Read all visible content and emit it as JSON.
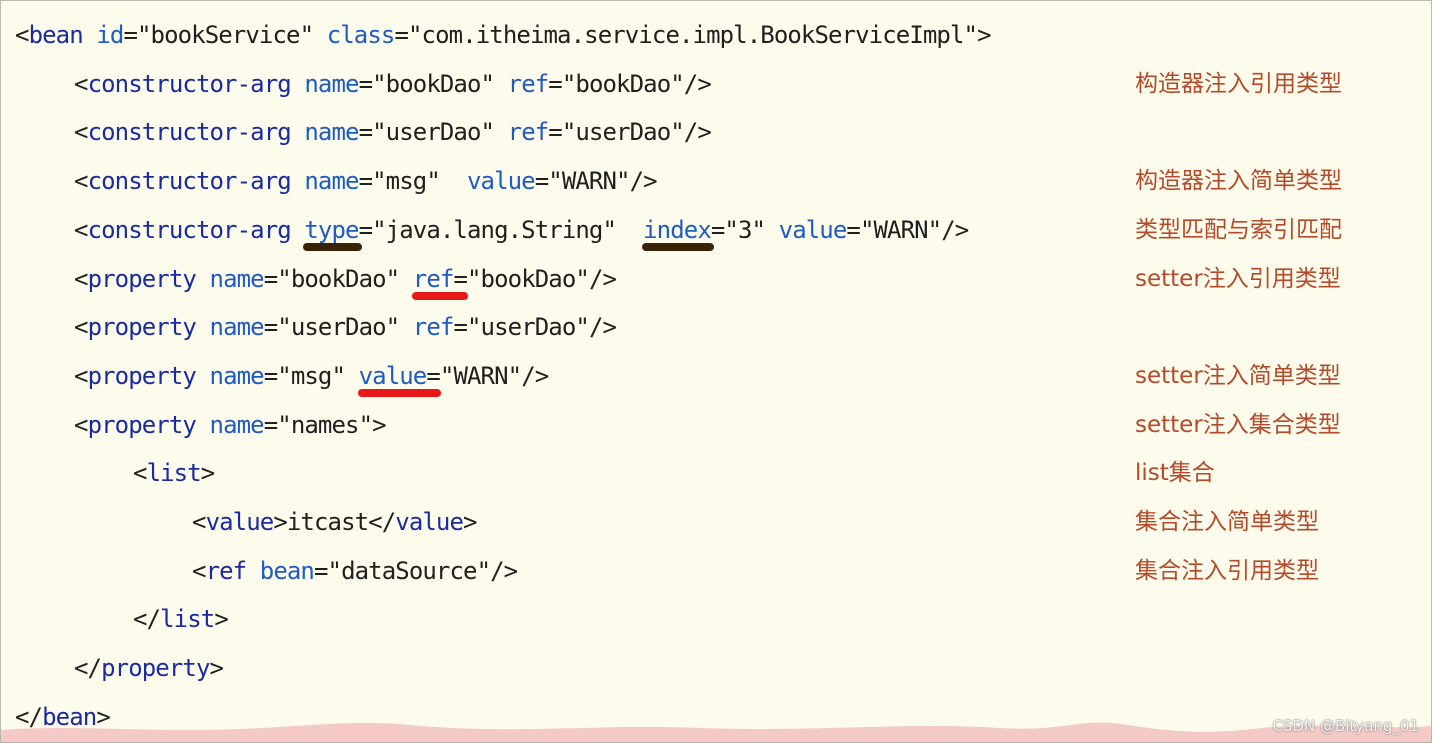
{
  "code_lines": [
    {
      "indent": 0,
      "parts": [
        {
          "t": "<",
          "c": "punc"
        },
        {
          "t": "bean",
          "c": "kw-tag"
        },
        {
          "t": " ",
          "c": "txt"
        },
        {
          "t": "id",
          "c": "kw-attr"
        },
        {
          "t": "=\"bookService\"",
          "c": "str"
        },
        {
          "t": " ",
          "c": "txt"
        },
        {
          "t": "class",
          "c": "kw-attr"
        },
        {
          "t": "=\"com.itheima.service.impl.BookServiceImpl\"",
          "c": "str"
        },
        {
          "t": ">",
          "c": "punc"
        }
      ]
    },
    {
      "indent": 1,
      "parts": [
        {
          "t": "<",
          "c": "punc"
        },
        {
          "t": "constructor-arg",
          "c": "kw-tag"
        },
        {
          "t": " ",
          "c": "txt"
        },
        {
          "t": "name",
          "c": "kw-attr"
        },
        {
          "t": "=\"bookDao\"",
          "c": "str"
        },
        {
          "t": " ",
          "c": "txt"
        },
        {
          "t": "ref",
          "c": "kw-attr"
        },
        {
          "t": "=\"bookDao\"",
          "c": "str"
        },
        {
          "t": "/>",
          "c": "punc"
        }
      ]
    },
    {
      "indent": 1,
      "parts": [
        {
          "t": "<",
          "c": "punc"
        },
        {
          "t": "constructor-arg",
          "c": "kw-tag"
        },
        {
          "t": " ",
          "c": "txt"
        },
        {
          "t": "name",
          "c": "kw-attr"
        },
        {
          "t": "=\"userDao\"",
          "c": "str"
        },
        {
          "t": " ",
          "c": "txt"
        },
        {
          "t": "ref",
          "c": "kw-attr"
        },
        {
          "t": "=\"userDao\"",
          "c": "str"
        },
        {
          "t": "/>",
          "c": "punc"
        }
      ]
    },
    {
      "indent": 1,
      "parts": [
        {
          "t": "<",
          "c": "punc"
        },
        {
          "t": "constructor-arg",
          "c": "kw-tag"
        },
        {
          "t": " ",
          "c": "txt"
        },
        {
          "t": "name",
          "c": "kw-attr"
        },
        {
          "t": "=\"msg\"",
          "c": "str"
        },
        {
          "t": "  ",
          "c": "txt"
        },
        {
          "t": "value",
          "c": "kw-attr"
        },
        {
          "t": "=\"WARN\"",
          "c": "str"
        },
        {
          "t": "/>",
          "c": "punc"
        }
      ]
    },
    {
      "indent": 1,
      "parts": [
        {
          "t": "<",
          "c": "punc"
        },
        {
          "t": "constructor-arg",
          "c": "kw-tag"
        },
        {
          "t": " ",
          "c": "txt"
        },
        {
          "t": "type",
          "c": "kw-attr"
        },
        {
          "t": "=\"java.lang.String\"",
          "c": "str"
        },
        {
          "t": "  ",
          "c": "txt"
        },
        {
          "t": "index",
          "c": "kw-attr"
        },
        {
          "t": "=\"3\"",
          "c": "str"
        },
        {
          "t": " ",
          "c": "txt"
        },
        {
          "t": "value",
          "c": "kw-attr"
        },
        {
          "t": "=\"WARN\"",
          "c": "str"
        },
        {
          "t": "/>",
          "c": "punc"
        }
      ]
    },
    {
      "indent": 1,
      "parts": [
        {
          "t": "<",
          "c": "punc"
        },
        {
          "t": "property",
          "c": "kw-tag"
        },
        {
          "t": " ",
          "c": "txt"
        },
        {
          "t": "name",
          "c": "kw-attr"
        },
        {
          "t": "=\"bookDao\"",
          "c": "str"
        },
        {
          "t": " ",
          "c": "txt"
        },
        {
          "t": "ref",
          "c": "kw-attr"
        },
        {
          "t": "=\"bookDao\"",
          "c": "str"
        },
        {
          "t": "/>",
          "c": "punc"
        }
      ]
    },
    {
      "indent": 1,
      "parts": [
        {
          "t": "<",
          "c": "punc"
        },
        {
          "t": "property",
          "c": "kw-tag"
        },
        {
          "t": " ",
          "c": "txt"
        },
        {
          "t": "name",
          "c": "kw-attr"
        },
        {
          "t": "=\"userDao\"",
          "c": "str"
        },
        {
          "t": " ",
          "c": "txt"
        },
        {
          "t": "ref",
          "c": "kw-attr"
        },
        {
          "t": "=\"userDao\"",
          "c": "str"
        },
        {
          "t": "/>",
          "c": "punc"
        }
      ]
    },
    {
      "indent": 1,
      "parts": [
        {
          "t": "<",
          "c": "punc"
        },
        {
          "t": "property",
          "c": "kw-tag"
        },
        {
          "t": " ",
          "c": "txt"
        },
        {
          "t": "name",
          "c": "kw-attr"
        },
        {
          "t": "=\"msg\"",
          "c": "str"
        },
        {
          "t": " ",
          "c": "txt"
        },
        {
          "t": "value",
          "c": "kw-attr"
        },
        {
          "t": "=\"WARN\"",
          "c": "str"
        },
        {
          "t": "/>",
          "c": "punc"
        }
      ]
    },
    {
      "indent": 1,
      "parts": [
        {
          "t": "<",
          "c": "punc"
        },
        {
          "t": "property",
          "c": "kw-tag"
        },
        {
          "t": " ",
          "c": "txt"
        },
        {
          "t": "name",
          "c": "kw-attr"
        },
        {
          "t": "=\"names\"",
          "c": "str"
        },
        {
          "t": ">",
          "c": "punc"
        }
      ]
    },
    {
      "indent": 2,
      "parts": [
        {
          "t": "<",
          "c": "punc"
        },
        {
          "t": "list",
          "c": "kw-tag"
        },
        {
          "t": ">",
          "c": "punc"
        }
      ]
    },
    {
      "indent": 3,
      "parts": [
        {
          "t": "<",
          "c": "punc"
        },
        {
          "t": "value",
          "c": "kw-tag"
        },
        {
          "t": ">",
          "c": "punc"
        },
        {
          "t": "itcast",
          "c": "txt"
        },
        {
          "t": "</",
          "c": "punc"
        },
        {
          "t": "value",
          "c": "kw-tag"
        },
        {
          "t": ">",
          "c": "punc"
        }
      ]
    },
    {
      "indent": 3,
      "parts": [
        {
          "t": "<",
          "c": "punc"
        },
        {
          "t": "ref",
          "c": "kw-tag"
        },
        {
          "t": " ",
          "c": "txt"
        },
        {
          "t": "bean",
          "c": "kw-attr"
        },
        {
          "t": "=\"dataSource\"",
          "c": "str"
        },
        {
          "t": "/>",
          "c": "punc"
        }
      ]
    },
    {
      "indent": 2,
      "parts": [
        {
          "t": "</",
          "c": "punc"
        },
        {
          "t": "list",
          "c": "kw-tag"
        },
        {
          "t": ">",
          "c": "punc"
        }
      ]
    },
    {
      "indent": 1,
      "parts": [
        {
          "t": "</",
          "c": "punc"
        },
        {
          "t": "property",
          "c": "kw-tag"
        },
        {
          "t": ">",
          "c": "punc"
        }
      ]
    },
    {
      "indent": 0,
      "parts": [
        {
          "t": "</",
          "c": "punc"
        },
        {
          "t": "bean",
          "c": "kw-tag"
        },
        {
          "t": ">",
          "c": "punc"
        }
      ]
    }
  ],
  "annotations": [
    {
      "line": 1,
      "text": "构造器注入引用类型"
    },
    {
      "line": 3,
      "text": "构造器注入简单类型"
    },
    {
      "line": 4,
      "text": "类型匹配与索引匹配"
    },
    {
      "line": 5,
      "text": "setter注入引用类型"
    },
    {
      "line": 7,
      "text": "setter注入简单类型"
    },
    {
      "line": 8,
      "text": "setter注入集合类型"
    },
    {
      "line": 9,
      "text": "list集合"
    },
    {
      "line": 10,
      "text": "集合注入简单类型"
    },
    {
      "line": 11,
      "text": "集合注入引用类型"
    }
  ],
  "highlight_marks": [
    {
      "line": 4,
      "target": "type",
      "color": "#3a2208"
    },
    {
      "line": 4,
      "target": "index",
      "color": "#3a2208"
    },
    {
      "line": 5,
      "target": "ref",
      "color": "#e81818"
    },
    {
      "line": 7,
      "target": "value",
      "color": "#e81818"
    }
  ],
  "colors": {
    "background": "#fdfbeb",
    "tag": "#1a2aa2",
    "attribute": "#1f5bc4",
    "annotation": "#b44a2a"
  },
  "watermark": "CSDN @Bityang_01"
}
